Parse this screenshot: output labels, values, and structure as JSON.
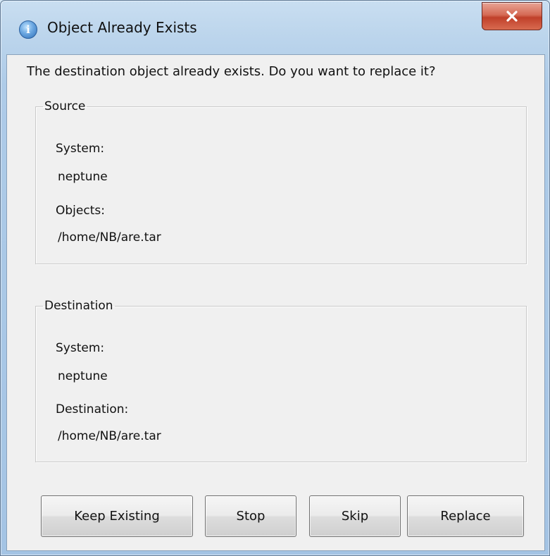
{
  "window": {
    "title": "Object Already Exists",
    "icon": "info-icon",
    "close_icon": "close-icon"
  },
  "message": "The destination object already exists. Do you want to replace it?",
  "source": {
    "legend": "Source",
    "system_label": "System:",
    "system_value": "neptune",
    "objects_label": "Objects:",
    "objects_value": "/home/NB/are.tar"
  },
  "destination": {
    "legend": "Destination",
    "system_label": "System:",
    "system_value": "neptune",
    "destination_label": "Destination:",
    "destination_value": "/home/NB/are.tar"
  },
  "buttons": {
    "keep_existing": "Keep Existing",
    "stop": "Stop",
    "skip": "Skip",
    "replace": "Replace"
  },
  "colors": {
    "close_button": "#c9452f",
    "dialog_background": "#f0f0f0",
    "title_bar": "#bcd5ec"
  }
}
